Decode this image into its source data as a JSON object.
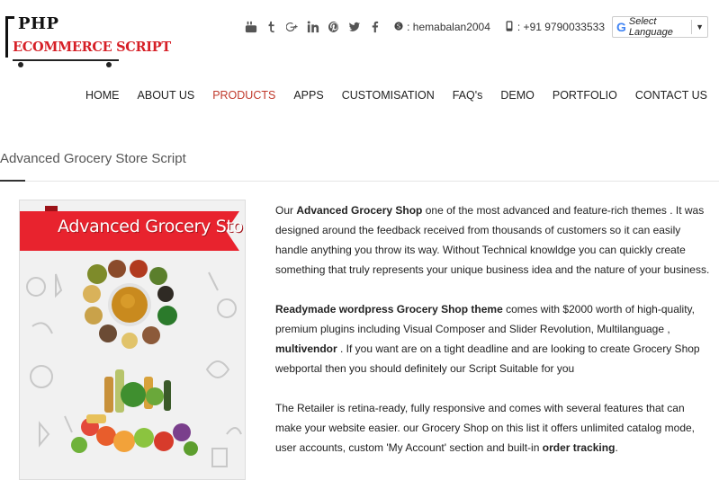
{
  "logo": {
    "line1": "PHP",
    "line2": "ECOMMERCE SCRIPT"
  },
  "social_icons": [
    "youtube-icon",
    "tumblr-icon",
    "google-plus-icon",
    "linkedin-icon",
    "pinterest-icon",
    "twitter-icon",
    "facebook-icon"
  ],
  "contact": {
    "skype": ": hemabalan2004",
    "phone": ": +91 9790033533"
  },
  "language": {
    "label": "Select Language",
    "logo": "G"
  },
  "nav": [
    {
      "label": "HOME"
    },
    {
      "label": "ABOUT US"
    },
    {
      "label": "PRODUCTS",
      "active": true
    },
    {
      "label": "APPS"
    },
    {
      "label": "CUSTOMISATION"
    },
    {
      "label": "FAQ's"
    },
    {
      "label": "DEMO"
    },
    {
      "label": "PORTFOLIO"
    },
    {
      "label": "CONTACT US"
    }
  ],
  "page_title": "Advanced Grocery Store Script",
  "product_image": {
    "banner_text": "Advanced Grocery Store"
  },
  "description": {
    "p1": {
      "before": "Our ",
      "bold": "Advanced Grocery Shop",
      "after": " one of the most advanced and feature-rich themes . It was designed around the feedback received from thousands of customers so it can easily handle anything you throw its way. Without Technical knowldge you can quickly create something that truly represents your unique business idea and the nature of your business."
    },
    "p2": {
      "bold1": "Readymade wordpress Grocery Shop theme",
      "middle": " comes with $2000 worth of high-quality, premium plugins including Visual Composer and Slider Revolution, Multilanguage , ",
      "bold2": "multivendor",
      "after": " . If you want are on a tight deadline and are looking to create Grocery Shop webportal then you should definitely our Script Suitable for you"
    },
    "p3": {
      "before": "The Retailer is retina-ready, fully responsive and comes with several features that can make your website easier. our Grocery Shop on this list it offers unlimited catalog mode, user accounts, custom 'My Account' section and built-in ",
      "bold": "order tracking",
      "after": "."
    }
  },
  "colors": {
    "accent": "#c0392b",
    "logo_red": "#d61f26",
    "banner_red": "#e8232e"
  }
}
